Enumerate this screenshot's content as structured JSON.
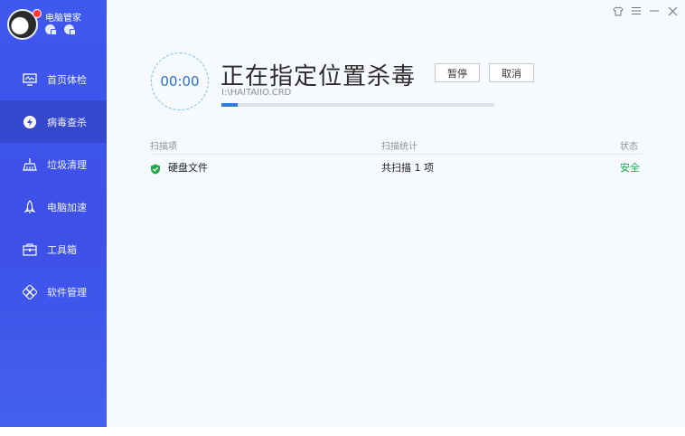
{
  "app": {
    "name": "电脑管家"
  },
  "window_controls": [
    {
      "name": "skin-icon"
    },
    {
      "name": "menu-icon"
    },
    {
      "name": "minimize-icon"
    },
    {
      "name": "close-icon"
    }
  ],
  "sidebar": {
    "items": [
      {
        "label": "首页体检",
        "icon": "monitor-icon",
        "active": false
      },
      {
        "label": "病毒查杀",
        "icon": "bolt-shield-icon",
        "active": true
      },
      {
        "label": "垃圾清理",
        "icon": "broom-icon",
        "active": false
      },
      {
        "label": "电脑加速",
        "icon": "rocket-icon",
        "active": false
      },
      {
        "label": "工具箱",
        "icon": "toolbox-icon",
        "active": false
      },
      {
        "label": "软件管理",
        "icon": "software-icon",
        "active": false
      }
    ]
  },
  "scan": {
    "timer": "00:00",
    "title": "正在指定位置杀毒",
    "pause_label": "暂停",
    "cancel_label": "取消",
    "path": "I:\\HAITAIIO.CRD",
    "progress": 0.06
  },
  "table": {
    "headers": {
      "item": "扫描项",
      "stats": "扫描统计",
      "status": "状态"
    },
    "rows": [
      {
        "item": "硬盘文件",
        "stats": "共扫描 1 项",
        "status": "安全"
      }
    ]
  },
  "colors": {
    "sidebar": "#3f58ee",
    "sidebar_active": "#3547cd",
    "accent": "#2e7fd9",
    "safe": "#21a94a"
  }
}
